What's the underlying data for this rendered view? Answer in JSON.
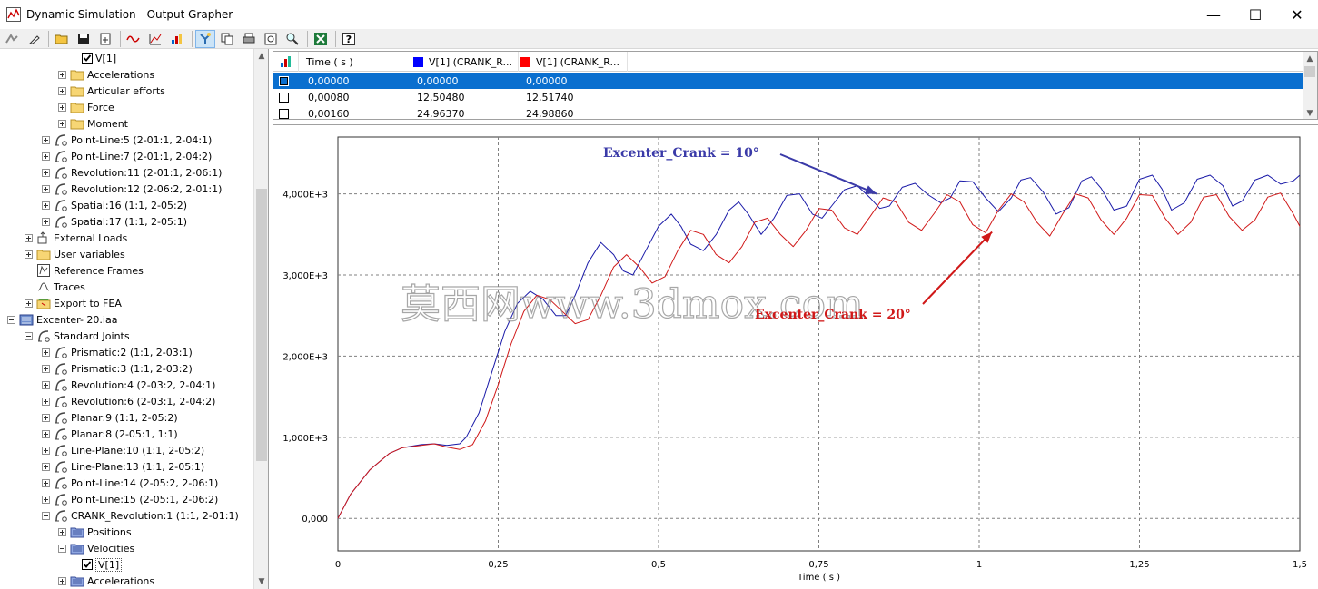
{
  "window": {
    "title": "Dynamic Simulation - Output Grapher",
    "controls": [
      "—",
      "☐",
      "✕"
    ]
  },
  "toolbar": {
    "icons": [
      "curve-edit-icon",
      "eraser-icon",
      "open-folder-icon",
      "save-icon",
      "export-icon",
      "curve-icon",
      "add-curve-icon",
      "chart-color-icon",
      "filter-icon",
      "copy-icon",
      "print-icon",
      "zoom-fit-icon",
      "zoom-icon",
      "excel-icon",
      "help-icon"
    ]
  },
  "tree": {
    "items": [
      {
        "label": "V[1]",
        "indent": 88,
        "kind": "checkbox",
        "checked": true
      },
      {
        "label": "Accelerations",
        "indent": 64,
        "kind": "folder"
      },
      {
        "label": "Articular efforts",
        "indent": 64,
        "kind": "folder"
      },
      {
        "label": "Force",
        "indent": 64,
        "kind": "folder"
      },
      {
        "label": "Moment",
        "indent": 64,
        "kind": "folder"
      },
      {
        "label": "Point-Line:5 (2-01:1, 2-04:1)",
        "indent": 46,
        "kind": "joint"
      },
      {
        "label": "Point-Line:7 (2-01:1, 2-04:2)",
        "indent": 46,
        "kind": "joint"
      },
      {
        "label": "Revolution:11 (2-01:1, 2-06:1)",
        "indent": 46,
        "kind": "joint"
      },
      {
        "label": "Revolution:12 (2-06:2, 2-01:1)",
        "indent": 46,
        "kind": "joint"
      },
      {
        "label": "Spatial:16 (1:1, 2-05:2)",
        "indent": 46,
        "kind": "joint"
      },
      {
        "label": "Spatial:17 (1:1, 2-05:1)",
        "indent": 46,
        "kind": "joint"
      },
      {
        "label": "External Loads",
        "indent": 27,
        "kind": "loads"
      },
      {
        "label": "User variables",
        "indent": 27,
        "kind": "folder"
      },
      {
        "label": "Reference Frames",
        "indent": 27,
        "kind": "frames",
        "noexp": true
      },
      {
        "label": "Traces",
        "indent": 27,
        "kind": "trace",
        "noexp": true
      },
      {
        "label": "Export to FEA",
        "indent": 27,
        "kind": "fea"
      },
      {
        "label": "Excenter- 20.iaa",
        "indent": 8,
        "kind": "doc",
        "open": true
      },
      {
        "label": "Standard Joints",
        "indent": 27,
        "kind": "joint",
        "open": true
      },
      {
        "label": "Prismatic:2 (1:1, 2-03:1)",
        "indent": 46,
        "kind": "joint"
      },
      {
        "label": "Prismatic:3 (1:1, 2-03:2)",
        "indent": 46,
        "kind": "joint"
      },
      {
        "label": "Revolution:4 (2-03:2, 2-04:1)",
        "indent": 46,
        "kind": "joint"
      },
      {
        "label": "Revolution:6 (2-03:1, 2-04:2)",
        "indent": 46,
        "kind": "joint"
      },
      {
        "label": "Planar:9 (1:1, 2-05:2)",
        "indent": 46,
        "kind": "joint"
      },
      {
        "label": "Planar:8 (2-05:1, 1:1)",
        "indent": 46,
        "kind": "joint"
      },
      {
        "label": "Line-Plane:10 (1:1, 2-05:2)",
        "indent": 46,
        "kind": "joint"
      },
      {
        "label": "Line-Plane:13 (1:1, 2-05:1)",
        "indent": 46,
        "kind": "joint"
      },
      {
        "label": "Point-Line:14 (2-05:2, 2-06:1)",
        "indent": 46,
        "kind": "joint"
      },
      {
        "label": "Point-Line:15 (2-05:1, 2-06:2)",
        "indent": 46,
        "kind": "joint"
      },
      {
        "label": "CRANK_Revolution:1 (1:1, 2-01:1)",
        "indent": 46,
        "kind": "joint",
        "open": true
      },
      {
        "label": "Positions",
        "indent": 64,
        "kind": "folder-blue"
      },
      {
        "label": "Velocities",
        "indent": 64,
        "kind": "folder-blue",
        "open": true
      },
      {
        "label": "V[1]",
        "indent": 88,
        "kind": "checkbox",
        "checked": true,
        "selected": true
      },
      {
        "label": "Accelerations",
        "indent": 64,
        "kind": "folder-blue"
      }
    ]
  },
  "table": {
    "columns": [
      {
        "label": "Time ( s )",
        "color": ""
      },
      {
        "label": "V[1] (CRANK_R...",
        "color": "#0000ff"
      },
      {
        "label": "V[1] (CRANK_R...",
        "color": "#ff0000"
      }
    ],
    "rows": [
      {
        "cells": [
          "0,00000",
          "0,00000",
          "0,00000"
        ],
        "selected": true
      },
      {
        "cells": [
          "0,00080",
          "12,50480",
          "12,51740"
        ],
        "selected": false
      },
      {
        "cells": [
          "0,00160",
          "24,96370",
          "24,98860"
        ],
        "selected": false
      }
    ]
  },
  "chart_data": {
    "type": "line",
    "xlabel": "Time ( s )",
    "ylabel": "",
    "xlim": [
      0,
      1.5
    ],
    "ylim": [
      -400,
      4700
    ],
    "x_ticks": [
      0,
      0.25,
      0.5,
      0.75,
      1,
      1.25,
      1.5
    ],
    "x_tick_labels": [
      "0",
      "0,25",
      "0,5",
      "0,75",
      "1",
      "1,25",
      "1,5"
    ],
    "y_ticks": [
      0,
      1000,
      2000,
      3000,
      4000
    ],
    "y_tick_labels": [
      "0,000",
      "1,000E+3",
      "2,000E+3",
      "3,000E+3",
      "4,000E+3"
    ],
    "grid": true,
    "series": [
      {
        "color": "#1a1aa8",
        "x": [
          0,
          0.02,
          0.05,
          0.08,
          0.1,
          0.13,
          0.15,
          0.17,
          0.19,
          0.2,
          0.22,
          0.24,
          0.26,
          0.28,
          0.3,
          0.32,
          0.34,
          0.355,
          0.37,
          0.39,
          0.41,
          0.43,
          0.445,
          0.46,
          0.48,
          0.5,
          0.52,
          0.535,
          0.55,
          0.57,
          0.59,
          0.61,
          0.625,
          0.64,
          0.66,
          0.68,
          0.7,
          0.72,
          0.74,
          0.755,
          0.77,
          0.79,
          0.81,
          0.83,
          0.845,
          0.86,
          0.88,
          0.9,
          0.92,
          0.94,
          0.955,
          0.97,
          0.99,
          1.01,
          1.03,
          1.05,
          1.065,
          1.08,
          1.1,
          1.12,
          1.14,
          1.16,
          1.175,
          1.19,
          1.21,
          1.23,
          1.25,
          1.27,
          1.285,
          1.3,
          1.32,
          1.34,
          1.36,
          1.38,
          1.395,
          1.41,
          1.43,
          1.45,
          1.47,
          1.49,
          1.5
        ],
        "y": [
          0,
          300,
          600,
          800,
          870,
          910,
          920,
          900,
          920,
          1000,
          1300,
          1800,
          2300,
          2650,
          2800,
          2700,
          2500,
          2500,
          2750,
          3150,
          3400,
          3250,
          3050,
          3000,
          3300,
          3600,
          3750,
          3600,
          3380,
          3300,
          3500,
          3800,
          3900,
          3750,
          3500,
          3700,
          3980,
          4000,
          3750,
          3700,
          3850,
          4050,
          4100,
          3950,
          3820,
          3850,
          4080,
          4130,
          3990,
          3890,
          3950,
          4160,
          4150,
          3950,
          3780,
          3950,
          4170,
          4200,
          4020,
          3750,
          3830,
          4160,
          4210,
          4070,
          3800,
          3850,
          4180,
          4230,
          4060,
          3800,
          3890,
          4180,
          4230,
          4100,
          3850,
          3910,
          4170,
          4230,
          4120,
          4160,
          4230
        ]
      },
      {
        "color": "#d01818",
        "x": [
          0,
          0.02,
          0.05,
          0.08,
          0.1,
          0.13,
          0.15,
          0.17,
          0.19,
          0.21,
          0.23,
          0.25,
          0.27,
          0.29,
          0.31,
          0.33,
          0.35,
          0.37,
          0.39,
          0.41,
          0.43,
          0.45,
          0.47,
          0.49,
          0.51,
          0.53,
          0.55,
          0.57,
          0.59,
          0.61,
          0.63,
          0.65,
          0.67,
          0.69,
          0.71,
          0.73,
          0.75,
          0.77,
          0.79,
          0.81,
          0.83,
          0.85,
          0.87,
          0.89,
          0.91,
          0.93,
          0.95,
          0.97,
          0.99,
          1.01,
          1.03,
          1.05,
          1.07,
          1.09,
          1.11,
          1.13,
          1.15,
          1.17,
          1.19,
          1.21,
          1.23,
          1.25,
          1.27,
          1.29,
          1.31,
          1.33,
          1.35,
          1.37,
          1.39,
          1.41,
          1.43,
          1.45,
          1.47,
          1.49,
          1.5
        ],
        "y": [
          0,
          300,
          600,
          800,
          870,
          900,
          920,
          880,
          850,
          910,
          1200,
          1650,
          2150,
          2550,
          2750,
          2700,
          2550,
          2400,
          2450,
          2750,
          3100,
          3250,
          3100,
          2900,
          2980,
          3300,
          3550,
          3500,
          3250,
          3150,
          3350,
          3650,
          3700,
          3500,
          3350,
          3550,
          3820,
          3800,
          3580,
          3500,
          3720,
          3950,
          3900,
          3650,
          3550,
          3760,
          3990,
          3900,
          3620,
          3520,
          3800,
          4000,
          3900,
          3650,
          3480,
          3750,
          4000,
          3950,
          3680,
          3500,
          3700,
          3990,
          3980,
          3700,
          3500,
          3650,
          3960,
          3990,
          3720,
          3550,
          3680,
          3960,
          4010,
          3750,
          3600
        ]
      }
    ],
    "annotations": [
      {
        "text": "Excenter_Crank = 10°",
        "color": "#3a3aa8",
        "arrow_to": [
          0.84,
          4000
        ]
      },
      {
        "text": "Excenter_Crank = 20°",
        "color": "#d01818",
        "arrow_to": [
          1.02,
          3530
        ]
      }
    ],
    "watermark": "莫西网www.3dmox.com"
  }
}
